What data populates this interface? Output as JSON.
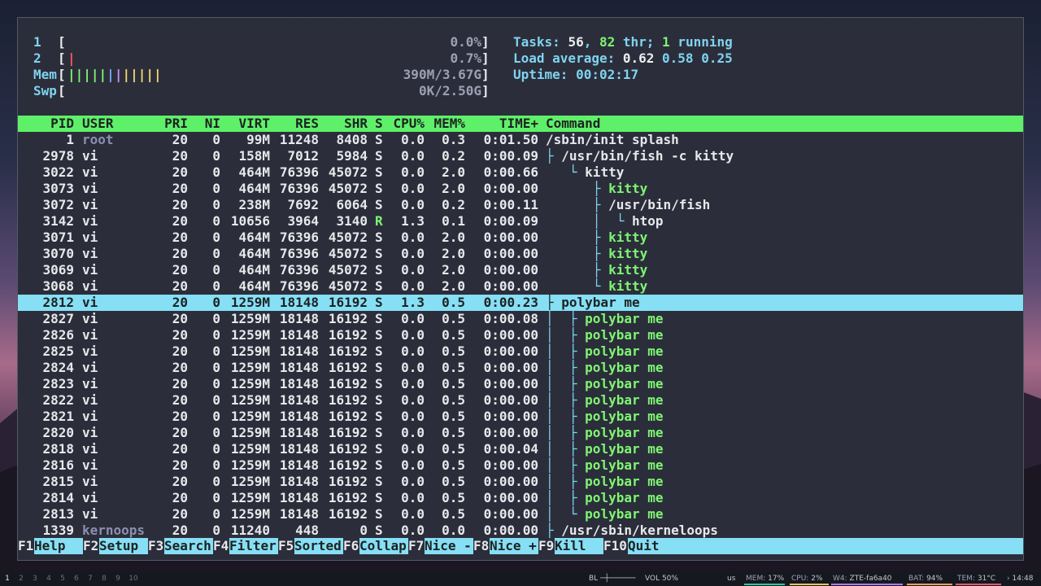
{
  "meters": {
    "cpu1": {
      "label": "1",
      "value": "0.0%"
    },
    "cpu2": {
      "label": "2",
      "value": "0.7%"
    },
    "mem": {
      "label": "Mem",
      "value": "390M/3.67G"
    },
    "swp": {
      "label": "Swp",
      "value": "0K/2.50G"
    }
  },
  "summary": {
    "tasks_label": "Tasks: ",
    "tasks_count": "56",
    "thr_sep": ", ",
    "thr_count": "82",
    "thr_label": " thr; ",
    "running_count": "1",
    "running_label": " running",
    "load_label": "Load average: ",
    "load1": "0.62",
    "load5": "0.58",
    "load15": "0.25",
    "uptime_label": "Uptime: ",
    "uptime": "00:02:17"
  },
  "columns": [
    "PID",
    "USER",
    "PRI",
    "NI",
    "VIRT",
    "RES",
    "SHR",
    "S",
    "CPU%",
    "MEM%",
    "TIME+",
    "Command"
  ],
  "processes": [
    {
      "pid": "1",
      "user": "root",
      "pri": "20",
      "ni": "0",
      "virt": "99M",
      "res": "11248",
      "shr": "8408",
      "s": "S",
      "cpu": "0.0",
      "mem": "0.3",
      "time": "0:01.50",
      "tree": "",
      "cmd": "/sbin/init splash",
      "thread": false,
      "selected": false
    },
    {
      "pid": "2978",
      "user": "vi",
      "pri": "20",
      "ni": "0",
      "virt": "158M",
      "res": "7012",
      "shr": "5984",
      "s": "S",
      "cpu": "0.0",
      "mem": "0.2",
      "time": "0:00.09",
      "tree": "├ ",
      "cmd": "/usr/bin/fish -c kitty",
      "thread": false,
      "selected": false
    },
    {
      "pid": "3022",
      "user": "vi",
      "pri": "20",
      "ni": "0",
      "virt": "464M",
      "res": "76396",
      "shr": "45072",
      "s": "S",
      "cpu": "0.0",
      "mem": "2.0",
      "time": "0:00.66",
      "tree": "   └ ",
      "cmd": "kitty",
      "thread": false,
      "selected": false
    },
    {
      "pid": "3073",
      "user": "vi",
      "pri": "20",
      "ni": "0",
      "virt": "464M",
      "res": "76396",
      "shr": "45072",
      "s": "S",
      "cpu": "0.0",
      "mem": "2.0",
      "time": "0:00.00",
      "tree": "      ├ ",
      "cmd": "kitty",
      "thread": true,
      "selected": false
    },
    {
      "pid": "3072",
      "user": "vi",
      "pri": "20",
      "ni": "0",
      "virt": "238M",
      "res": "7692",
      "shr": "6064",
      "s": "S",
      "cpu": "0.0",
      "mem": "0.2",
      "time": "0:00.11",
      "tree": "      ├ ",
      "cmd": "/usr/bin/fish",
      "thread": false,
      "selected": false
    },
    {
      "pid": "3142",
      "user": "vi",
      "pri": "20",
      "ni": "0",
      "virt": "10656",
      "res": "3964",
      "shr": "3140",
      "s": "R",
      "cpu": "1.3",
      "mem": "0.1",
      "time": "0:00.09",
      "tree": "      │  └ ",
      "cmd": "htop",
      "thread": false,
      "selected": false
    },
    {
      "pid": "3071",
      "user": "vi",
      "pri": "20",
      "ni": "0",
      "virt": "464M",
      "res": "76396",
      "shr": "45072",
      "s": "S",
      "cpu": "0.0",
      "mem": "2.0",
      "time": "0:00.00",
      "tree": "      ├ ",
      "cmd": "kitty",
      "thread": true,
      "selected": false
    },
    {
      "pid": "3070",
      "user": "vi",
      "pri": "20",
      "ni": "0",
      "virt": "464M",
      "res": "76396",
      "shr": "45072",
      "s": "S",
      "cpu": "0.0",
      "mem": "2.0",
      "time": "0:00.00",
      "tree": "      ├ ",
      "cmd": "kitty",
      "thread": true,
      "selected": false
    },
    {
      "pid": "3069",
      "user": "vi",
      "pri": "20",
      "ni": "0",
      "virt": "464M",
      "res": "76396",
      "shr": "45072",
      "s": "S",
      "cpu": "0.0",
      "mem": "2.0",
      "time": "0:00.00",
      "tree": "      ├ ",
      "cmd": "kitty",
      "thread": true,
      "selected": false
    },
    {
      "pid": "3068",
      "user": "vi",
      "pri": "20",
      "ni": "0",
      "virt": "464M",
      "res": "76396",
      "shr": "45072",
      "s": "S",
      "cpu": "0.0",
      "mem": "2.0",
      "time": "0:00.00",
      "tree": "      └ ",
      "cmd": "kitty",
      "thread": true,
      "selected": false
    },
    {
      "pid": "2812",
      "user": "vi",
      "pri": "20",
      "ni": "0",
      "virt": "1259M",
      "res": "18148",
      "shr": "16192",
      "s": "S",
      "cpu": "1.3",
      "mem": "0.5",
      "time": "0:00.23",
      "tree": "├ ",
      "cmd": "polybar me",
      "thread": false,
      "selected": true
    },
    {
      "pid": "2827",
      "user": "vi",
      "pri": "20",
      "ni": "0",
      "virt": "1259M",
      "res": "18148",
      "shr": "16192",
      "s": "S",
      "cpu": "0.0",
      "mem": "0.5",
      "time": "0:00.08",
      "tree": "│  ├ ",
      "cmd": "polybar me",
      "thread": true,
      "selected": false
    },
    {
      "pid": "2826",
      "user": "vi",
      "pri": "20",
      "ni": "0",
      "virt": "1259M",
      "res": "18148",
      "shr": "16192",
      "s": "S",
      "cpu": "0.0",
      "mem": "0.5",
      "time": "0:00.00",
      "tree": "│  ├ ",
      "cmd": "polybar me",
      "thread": true,
      "selected": false
    },
    {
      "pid": "2825",
      "user": "vi",
      "pri": "20",
      "ni": "0",
      "virt": "1259M",
      "res": "18148",
      "shr": "16192",
      "s": "S",
      "cpu": "0.0",
      "mem": "0.5",
      "time": "0:00.00",
      "tree": "│  ├ ",
      "cmd": "polybar me",
      "thread": true,
      "selected": false
    },
    {
      "pid": "2824",
      "user": "vi",
      "pri": "20",
      "ni": "0",
      "virt": "1259M",
      "res": "18148",
      "shr": "16192",
      "s": "S",
      "cpu": "0.0",
      "mem": "0.5",
      "time": "0:00.00",
      "tree": "│  ├ ",
      "cmd": "polybar me",
      "thread": true,
      "selected": false
    },
    {
      "pid": "2823",
      "user": "vi",
      "pri": "20",
      "ni": "0",
      "virt": "1259M",
      "res": "18148",
      "shr": "16192",
      "s": "S",
      "cpu": "0.0",
      "mem": "0.5",
      "time": "0:00.00",
      "tree": "│  ├ ",
      "cmd": "polybar me",
      "thread": true,
      "selected": false
    },
    {
      "pid": "2822",
      "user": "vi",
      "pri": "20",
      "ni": "0",
      "virt": "1259M",
      "res": "18148",
      "shr": "16192",
      "s": "S",
      "cpu": "0.0",
      "mem": "0.5",
      "time": "0:00.00",
      "tree": "│  ├ ",
      "cmd": "polybar me",
      "thread": true,
      "selected": false
    },
    {
      "pid": "2821",
      "user": "vi",
      "pri": "20",
      "ni": "0",
      "virt": "1259M",
      "res": "18148",
      "shr": "16192",
      "s": "S",
      "cpu": "0.0",
      "mem": "0.5",
      "time": "0:00.00",
      "tree": "│  ├ ",
      "cmd": "polybar me",
      "thread": true,
      "selected": false
    },
    {
      "pid": "2820",
      "user": "vi",
      "pri": "20",
      "ni": "0",
      "virt": "1259M",
      "res": "18148",
      "shr": "16192",
      "s": "S",
      "cpu": "0.0",
      "mem": "0.5",
      "time": "0:00.00",
      "tree": "│  ├ ",
      "cmd": "polybar me",
      "thread": true,
      "selected": false
    },
    {
      "pid": "2818",
      "user": "vi",
      "pri": "20",
      "ni": "0",
      "virt": "1259M",
      "res": "18148",
      "shr": "16192",
      "s": "S",
      "cpu": "0.0",
      "mem": "0.5",
      "time": "0:00.04",
      "tree": "│  ├ ",
      "cmd": "polybar me",
      "thread": true,
      "selected": false
    },
    {
      "pid": "2816",
      "user": "vi",
      "pri": "20",
      "ni": "0",
      "virt": "1259M",
      "res": "18148",
      "shr": "16192",
      "s": "S",
      "cpu": "0.0",
      "mem": "0.5",
      "time": "0:00.00",
      "tree": "│  ├ ",
      "cmd": "polybar me",
      "thread": true,
      "selected": false
    },
    {
      "pid": "2815",
      "user": "vi",
      "pri": "20",
      "ni": "0",
      "virt": "1259M",
      "res": "18148",
      "shr": "16192",
      "s": "S",
      "cpu": "0.0",
      "mem": "0.5",
      "time": "0:00.00",
      "tree": "│  ├ ",
      "cmd": "polybar me",
      "thread": true,
      "selected": false
    },
    {
      "pid": "2814",
      "user": "vi",
      "pri": "20",
      "ni": "0",
      "virt": "1259M",
      "res": "18148",
      "shr": "16192",
      "s": "S",
      "cpu": "0.0",
      "mem": "0.5",
      "time": "0:00.00",
      "tree": "│  ├ ",
      "cmd": "polybar me",
      "thread": true,
      "selected": false
    },
    {
      "pid": "2813",
      "user": "vi",
      "pri": "20",
      "ni": "0",
      "virt": "1259M",
      "res": "18148",
      "shr": "16192",
      "s": "S",
      "cpu": "0.0",
      "mem": "0.5",
      "time": "0:00.00",
      "tree": "│  └ ",
      "cmd": "polybar me",
      "thread": true,
      "selected": false
    },
    {
      "pid": "1339",
      "user": "kernoops",
      "pri": "20",
      "ni": "0",
      "virt": "11240",
      "res": "448",
      "shr": "0",
      "s": "S",
      "cpu": "0.0",
      "mem": "0.0",
      "time": "0:00.00",
      "tree": "├ ",
      "cmd": "/usr/sbin/kerneloops",
      "thread": false,
      "selected": false
    }
  ],
  "footer": [
    {
      "key": "F1",
      "label": "Help  "
    },
    {
      "key": "F2",
      "label": "Setup "
    },
    {
      "key": "F3",
      "label": "Search"
    },
    {
      "key": "F4",
      "label": "Filter"
    },
    {
      "key": "F5",
      "label": "Sorted"
    },
    {
      "key": "F6",
      "label": "Collap"
    },
    {
      "key": "F7",
      "label": "Nice -"
    },
    {
      "key": "F8",
      "label": "Nice +"
    },
    {
      "key": "F9",
      "label": "Kill  "
    },
    {
      "key": "F10",
      "label": "Quit"
    }
  ],
  "statusbar": {
    "workspaces": [
      "1",
      "2",
      "3",
      "4",
      "5",
      "6",
      "7",
      "8",
      "9",
      "10"
    ],
    "backlight_label": "BL",
    "volume": "VOL 50%",
    "layout": "us",
    "mem_label": "MEM:",
    "mem_value": "17%",
    "cpu_label": "CPU:",
    "cpu_value": "2%",
    "wifi_label": "W4:",
    "wifi_value": "ZTE-fa6a40",
    "bat_label": "BAT:",
    "bat_value": "94%",
    "temp_label": "TEM:",
    "temp_value": "31°C",
    "clock": "14:48"
  },
  "colors": {
    "header_bg": "#5ff06a",
    "selection_bg": "#86dff5",
    "terminal_bg": "#2b2e3a",
    "accent_cyan": "#7fd3f0",
    "thread_green": "#7ff573"
  }
}
